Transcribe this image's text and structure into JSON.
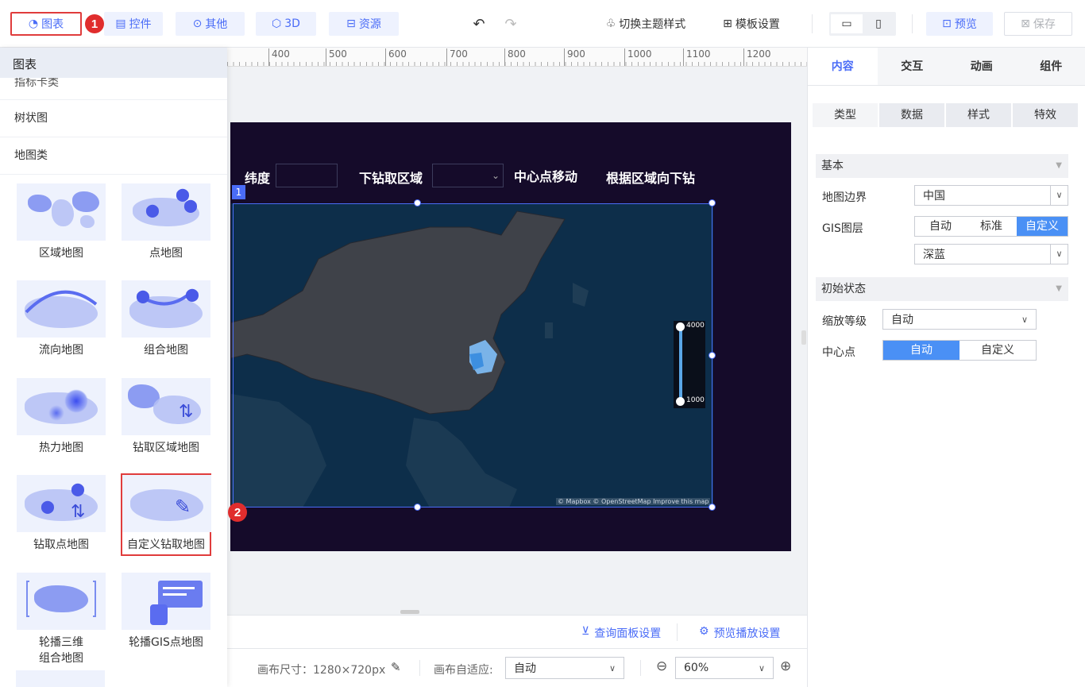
{
  "toolbar": {
    "chart_label": "图表",
    "control_label": "控件",
    "other_label": "其他",
    "threed_label": "3D",
    "resource_label": "资源",
    "theme_label": "切换主题样式",
    "template_label": "模板设置",
    "preview_label": "预览",
    "save_label": "保存",
    "marker1": "1",
    "marker2": "2"
  },
  "left_panel": {
    "header": "图表",
    "categories": [
      "指标卡类",
      "树状图",
      "地图类"
    ],
    "cards": [
      {
        "label": "区域地图"
      },
      {
        "label": "点地图"
      },
      {
        "label": "流向地图"
      },
      {
        "label": "组合地图"
      },
      {
        "label": "热力地图"
      },
      {
        "label": "钻取区域地图"
      },
      {
        "label": "钻取点地图"
      },
      {
        "label": "自定义钻取地图"
      },
      {
        "label": "轮播三维\n组合地图"
      },
      {
        "label": "轮播GIS点地图"
      }
    ]
  },
  "ruler": {
    "ticks": [
      "400",
      "500",
      "600",
      "700",
      "800",
      "900",
      "1000",
      "1100",
      "1200"
    ]
  },
  "screen": {
    "latitude_label": "纬度",
    "drill_area_label": "下钻取区域",
    "center_move_label": "中心点移动",
    "drill_by_region_label": "根据区域向下钻",
    "widget_tag": "1",
    "legend_max": "4000",
    "legend_min": "1000",
    "attribution": "© Mapbox © OpenStreetMap Improve this map"
  },
  "bottom": {
    "query_panel": "查询面板设置",
    "preview_play": "预览播放设置",
    "canvas_size_label": "画布尺寸：1280×720px",
    "adapt_label": "画布自适应:",
    "adapt_value": "自动",
    "zoom_value": "60%"
  },
  "right_panel": {
    "tabs": [
      "内容",
      "交互",
      "动画",
      "组件"
    ],
    "sub_tabs": [
      "类型",
      "数据",
      "样式",
      "特效"
    ],
    "section_basic": "基本",
    "map_border_label": "地图边界",
    "map_border_value": "中国",
    "gis_layer_label": "GIS图层",
    "gis_options": [
      "自动",
      "标准",
      "自定义"
    ],
    "gis_style_value": "深蓝",
    "section_initial": "初始状态",
    "zoom_label": "缩放等级",
    "zoom_value": "自动",
    "center_label": "中心点",
    "center_options": [
      "自动",
      "自定义"
    ]
  },
  "colors": {
    "accent": "#4a6cf7",
    "marker": "#e02d2d",
    "screen_bg": "#150b2a",
    "map_bg": "#0d2e4a"
  }
}
